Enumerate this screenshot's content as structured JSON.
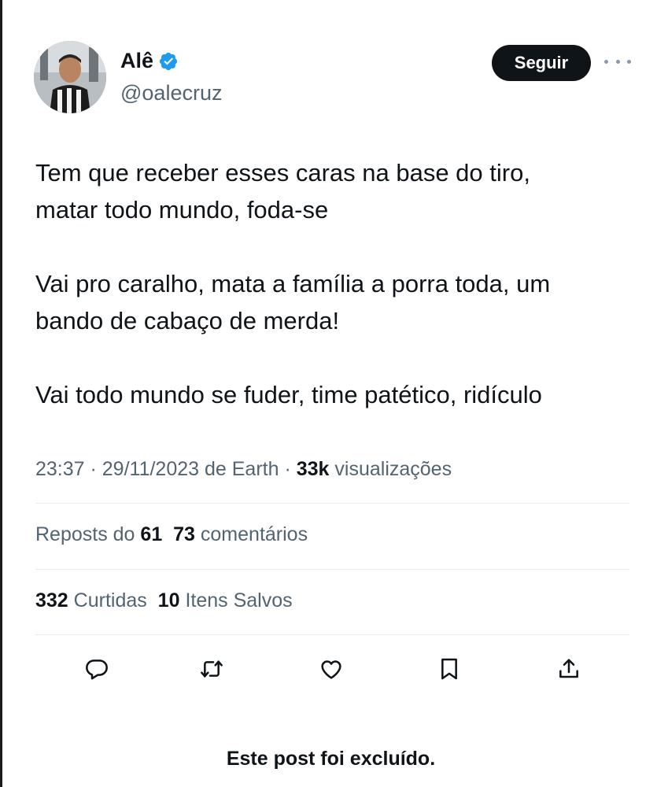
{
  "author": {
    "display_name": "Alê",
    "handle": "@oalecruz",
    "verified": true
  },
  "follow_label": "Seguir",
  "tweet": {
    "paragraphs": [
      [
        "Tem que receber esses caras na base do tiro,",
        "matar todo mundo, foda-se"
      ],
      [
        "Vai pro caralho, mata a família a porra toda, um",
        "bando de cabaço de merda!"
      ],
      [
        "Vai todo mundo se fuder, time patético, ridículo"
      ]
    ]
  },
  "meta": {
    "time": "23:37",
    "separator": " · ",
    "date": "29/11/2023 de Earth",
    "views_count": "33k",
    "views_label": "visualizações"
  },
  "stats_row1": {
    "reposts_label": "Reposts do",
    "reposts_count": "61",
    "comments_count": "73",
    "comments_label": "comentários"
  },
  "stats_row2": {
    "likes_count": "332",
    "likes_label": "Curtidas",
    "saves_count": "10",
    "saves_label": "Itens Salvos"
  },
  "actions": [
    "reply-icon",
    "repost-icon",
    "like-icon",
    "bookmark-icon",
    "share-icon"
  ],
  "deleted_notice": "Este post foi excluído.",
  "colors": {
    "text": "#0f1419",
    "secondary": "#536471",
    "verified": "#1d9bf0",
    "button_bg": "#0f1419",
    "divider": "#e6ecf0"
  }
}
